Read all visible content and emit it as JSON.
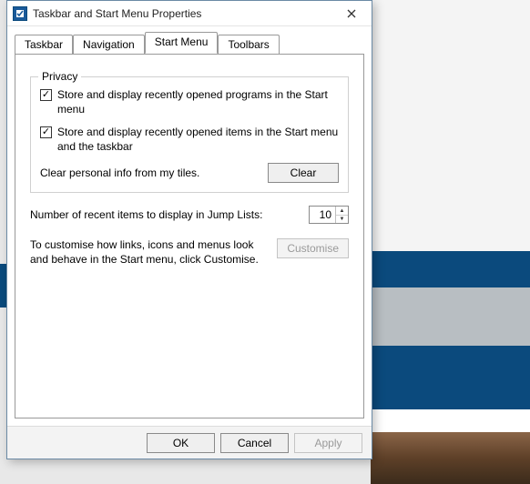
{
  "window": {
    "title": "Taskbar and Start Menu Properties"
  },
  "tabs": {
    "taskbar": "Taskbar",
    "navigation": "Navigation",
    "startmenu": "Start Menu",
    "toolbars": "Toolbars",
    "active": "startmenu"
  },
  "privacy": {
    "group_title": "Privacy",
    "store_programs": {
      "checked": true,
      "label": "Store and display recently opened programs in the Start menu"
    },
    "store_items": {
      "checked": true,
      "label": "Store and display recently opened items in the Start menu and the taskbar"
    },
    "clear_label": "Clear personal info from my tiles.",
    "clear_button": "Clear"
  },
  "jumplist": {
    "label": "Number of recent items to display in Jump Lists:",
    "value": "10"
  },
  "customise": {
    "hint": "To customise how links, icons and menus look and behave in the Start menu, click Customise.",
    "button": "Customise"
  },
  "footer": {
    "ok": "OK",
    "cancel": "Cancel",
    "apply": "Apply"
  }
}
